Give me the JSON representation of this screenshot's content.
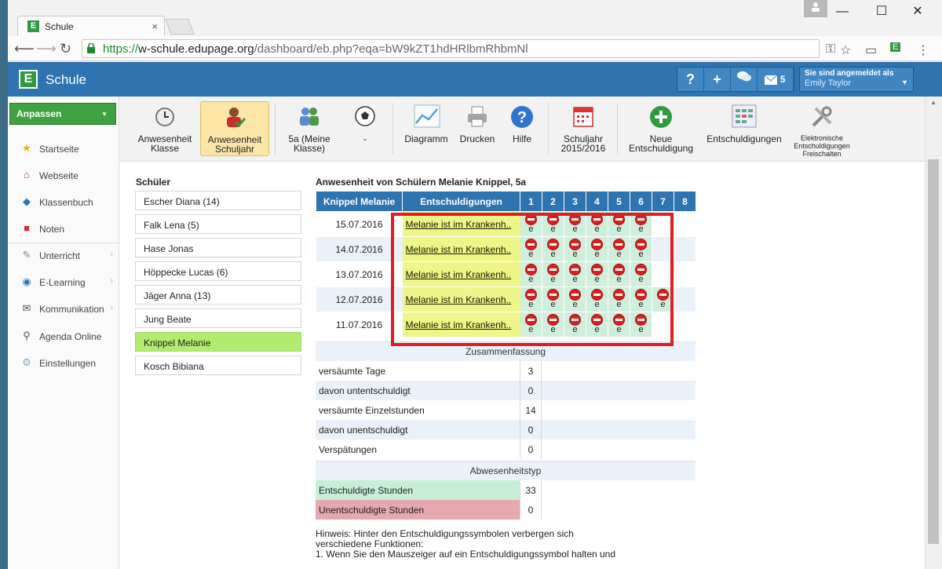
{
  "browser": {
    "tab_title": "Schule",
    "tab_close": "×",
    "url_scheme": "https://",
    "url_host": "w-schule.edupage.org",
    "url_path": "/dashboard/eb.php?eqa=bW9kZT1hdHRlbmRhbmNl",
    "min": "—",
    "max": "☐",
    "close": "✕"
  },
  "app": {
    "name": "Schule",
    "logo": "E",
    "help": "?",
    "add": "+",
    "messages_count": "5",
    "login_label": "Sie sind angemeldet als",
    "user_name": "Emily Taylor"
  },
  "sidebar": {
    "customize": "Anpassen",
    "items": [
      {
        "label": "Startseite",
        "icon": "star-icon"
      },
      {
        "label": "Webseite",
        "icon": "house-icon"
      },
      {
        "label": "Klassenbuch",
        "icon": "book-icon"
      },
      {
        "label": "Noten",
        "icon": "grades-icon"
      },
      {
        "label": "Unterricht",
        "icon": "pen-icon"
      },
      {
        "label": "E-Learning",
        "icon": "globe-icon"
      },
      {
        "label": "Kommunikation",
        "icon": "chat-icon"
      },
      {
        "label": "Agenda Online",
        "icon": "satellite-icon"
      },
      {
        "label": "Einstellungen",
        "icon": "gear-icon"
      }
    ]
  },
  "toolbar": {
    "b1": "Anwesenheit Klasse",
    "b2": "Anwesenheit Schuljahr",
    "b3": "5a (Meine Klasse)",
    "b4": "-",
    "b5": "Diagramm",
    "b6": "Drucken",
    "b7": "Hilfe",
    "b8": "Schuljahr 2015/2016",
    "b9": "Neue Entschuldigung",
    "b10": "Entschuldigungen",
    "b11": "Elektronische Entschuldigungen Freischalten"
  },
  "students": {
    "heading": "Schüler",
    "list": [
      "Escher Diana (14)",
      "Falk Lena (5)",
      "Hase Jonas",
      "Höppecke Lucas (6)",
      "Jäger Anna (13)",
      "Jung Beate",
      "Knippel Melanie",
      "Kosch Bibiana"
    ]
  },
  "attendance": {
    "heading": "Anwesenheit von Schülern Melanie Knippel, 5a",
    "col_name": "Knippel Melanie",
    "col_excuses": "Entschuldigungen",
    "periods": [
      "1",
      "2",
      "3",
      "4",
      "5",
      "6",
      "7",
      "8"
    ],
    "excuse_text": "Melanie ist im Krankenh..",
    "mark": "e",
    "rows": [
      {
        "date": "15.07.2016",
        "absent_periods": 6
      },
      {
        "date": "14.07.2016",
        "absent_periods": 6
      },
      {
        "date": "13.07.2016",
        "absent_periods": 6
      },
      {
        "date": "12.07.2016",
        "absent_periods": 7
      },
      {
        "date": "11.07.2016",
        "absent_periods": 6
      }
    ]
  },
  "summary": {
    "title": "Zusammenfassung",
    "rows": [
      {
        "label": "versäumte Tage",
        "value": "3"
      },
      {
        "label": "davon untentschuldigt",
        "value": "0"
      },
      {
        "label": "versäumte Einzelstunden",
        "value": "14"
      },
      {
        "label": "davon unentschuldigt",
        "value": "0"
      },
      {
        "label": "Verspätungen",
        "value": "0"
      }
    ],
    "type_title": "Abwesenheitstyp",
    "excused_label": "Entschuldigte Stunden",
    "excused_value": "33",
    "unexcused_label": "Unentschuldigte Stunden",
    "unexcused_value": "0"
  },
  "hint": {
    "line1": "Hinweis: Hinter den Entschuldigungssymbolen verbergen sich",
    "line2": "verschiedene Funktionen:",
    "line3": "1. Wenn Sie den Mauszeiger auf ein Entschuldigungssymbol halten und"
  },
  "colors": {
    "accent": "#2e74b0",
    "green": "#3fa142",
    "highlight": "#e01d24"
  }
}
